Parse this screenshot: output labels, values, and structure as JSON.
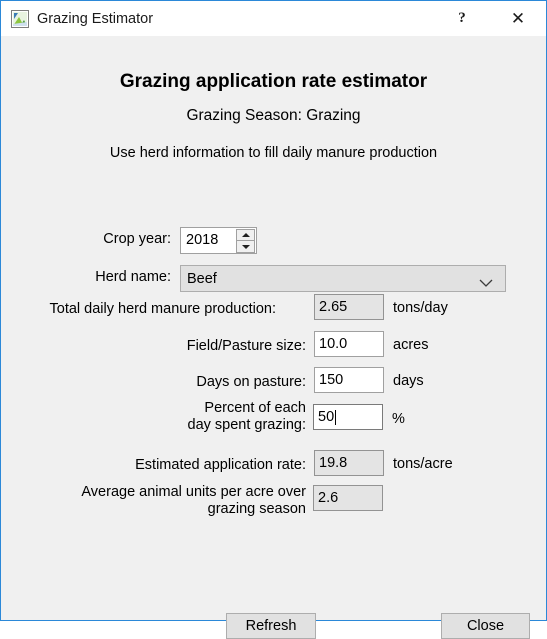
{
  "window": {
    "title": "Grazing Estimator",
    "icon": "app-document-icon",
    "help_label": "?",
    "close_label": "✕",
    "accent_color": "#2b88d8",
    "client_background": "#f0f0f0"
  },
  "headings": {
    "main": "Grazing application rate estimator",
    "season": "Grazing Season: Grazing",
    "hint": "Use herd information to fill daily manure production"
  },
  "crop_year": {
    "label": "Crop year:",
    "value": "2018",
    "spin_up_icon": "triangle-up-icon",
    "spin_down_icon": "triangle-down-icon"
  },
  "herd_name": {
    "label": "Herd name:",
    "value": "Beef",
    "chevron_icon": "chevron-down-icon"
  },
  "fields": [
    {
      "id": "total-daily-manure",
      "label": "Total daily herd manure production:",
      "value": "2.65",
      "unit": "tons/day",
      "readonly": true,
      "focused": false
    },
    {
      "id": "field-pasture-size",
      "label": "Field/Pasture size:",
      "value": "10.0",
      "unit": "acres",
      "readonly": false,
      "focused": false
    },
    {
      "id": "days-on-pasture",
      "label": "Days on pasture:",
      "value": "150",
      "unit": "days",
      "readonly": false,
      "focused": false
    },
    {
      "id": "percent-day-grazing",
      "label": "Percent of each\nday spent grazing:",
      "value": "50",
      "unit": "%",
      "readonly": false,
      "focused": true
    },
    {
      "id": "estimated-application-rate",
      "label": "Estimated application rate:",
      "value": "19.8",
      "unit": "tons/acre",
      "readonly": true,
      "focused": false
    },
    {
      "id": "average-animal-units",
      "label": "Average animal units per acre over\ngrazing season",
      "value": "2.6",
      "unit": "",
      "readonly": true,
      "focused": false
    }
  ],
  "buttons": {
    "refresh": "Refresh",
    "close": "Close"
  }
}
